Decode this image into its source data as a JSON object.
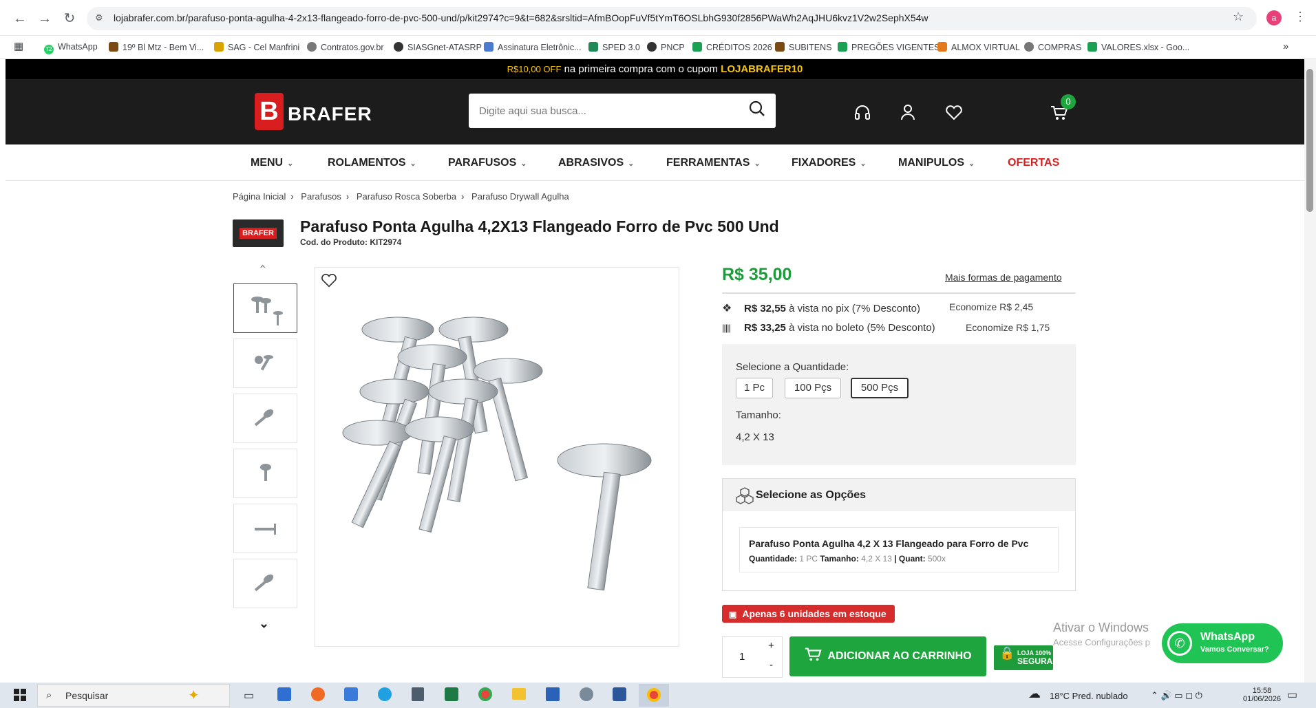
{
  "browser": {
    "url": "lojabrafer.com.br/parafuso-ponta-agulha-4-2x13-flangeado-forro-de-pvc-500-und/p/kit2974?c=9&t=682&srsltid=AfmBOopFuVf5tYmT6OSLbhG930f2856PWaWh2AqJHU6kvz1V2w2SephX54w",
    "profile_initial": "a",
    "bookmarks": [
      "WhatsApp",
      "19º Bl Mtz - Bem Vi...",
      "SAG - Cel Manfrini",
      "Contratos.gov.br",
      "SIASGnet-ATASRP",
      "Assinatura Eletrônic...",
      "SPED 3.0",
      "PNCP",
      "CRÉDITOS 2026",
      "SUBITENS",
      "PREGÕES VIGENTES",
      "ALMOX VIRTUAL",
      "COMPRAS",
      "VALORES.xlsx - Goo..."
    ],
    "whatsapp_badge": "72"
  },
  "promo": {
    "amount": "R$10,00 OFF",
    "text": "na primeira compra com o cupom",
    "coupon": "LOJABRAFER10"
  },
  "header": {
    "logo_text": "BRAFER",
    "search_placeholder": "Digite aqui sua busca...",
    "cart_count": "0"
  },
  "nav": [
    {
      "label": "MENU",
      "caret": "⌄"
    },
    {
      "label": "ROLAMENTOS",
      "caret": "⌄"
    },
    {
      "label": "PARAFUSOS",
      "caret": "⌄"
    },
    {
      "label": "ABRASIVOS",
      "caret": "⌄"
    },
    {
      "label": "FERRAMENTAS",
      "caret": "⌄"
    },
    {
      "label": "FIXADORES",
      "caret": "⌄"
    },
    {
      "label": "MANIPULOS",
      "caret": "⌄"
    },
    {
      "label": "OFERTAS",
      "caret": ""
    }
  ],
  "breadcrumb": [
    "Página Inicial",
    "Parafusos",
    "Parafuso Rosca Soberba",
    "Parafuso Drywall Agulha"
  ],
  "product": {
    "brand_badge": "BRAFER",
    "title": "Parafuso Ponta Agulha 4,2X13 Flangeado Forro de Pvc 500 Und",
    "code_label": "Cod. do Produto:",
    "code": "KIT2974",
    "price": "R$ 35,00",
    "more_payment": "Mais formas de pagamento",
    "pix": {
      "value": "R$ 32,55",
      "text": "à vista no pix (7% Desconto)",
      "economy": "Economize R$ 2,45"
    },
    "boleto": {
      "value": "R$ 33,25",
      "text": "à vista no boleto (5% Desconto)",
      "economy": "Economize R$ 1,75"
    },
    "qty_label": "Selecione a Quantidade:",
    "qty_options": [
      "1 Pc",
      "100 Pçs",
      "500 Pçs"
    ],
    "size_label": "Tamanho:",
    "size_value": "4,2 X 13",
    "options_title": "Selecione as Opções",
    "option_name": "Parafuso Ponta Agulha 4,2 X 13 Flangeado para Forro de Pvc",
    "option_qty_label": "Quantidade:",
    "option_qty_value": "1 PC",
    "option_size_label": "Tamanho:",
    "option_size_value": "4,2 X 13",
    "option_quant_label": "| Quant:",
    "option_quant_value": "500x",
    "stock": "Apenas 6 unidades em estoque",
    "quantity": "1",
    "add_to_cart": "ADICIONAR AO CARRINHO",
    "seal_line1": "LOJA 100%",
    "seal_line2": "SEGURA"
  },
  "windows_activation": {
    "title": "Ativar o Windows",
    "subtitle": "Acesse Configurações p"
  },
  "whatsapp_float": {
    "title": "WhatsApp",
    "subtitle": "Vamos Conversar?"
  },
  "taskbar": {
    "search": "Pesquisar",
    "weather": "18°C  Pred. nublado",
    "time": "15:58",
    "date": "01/06/2026"
  }
}
